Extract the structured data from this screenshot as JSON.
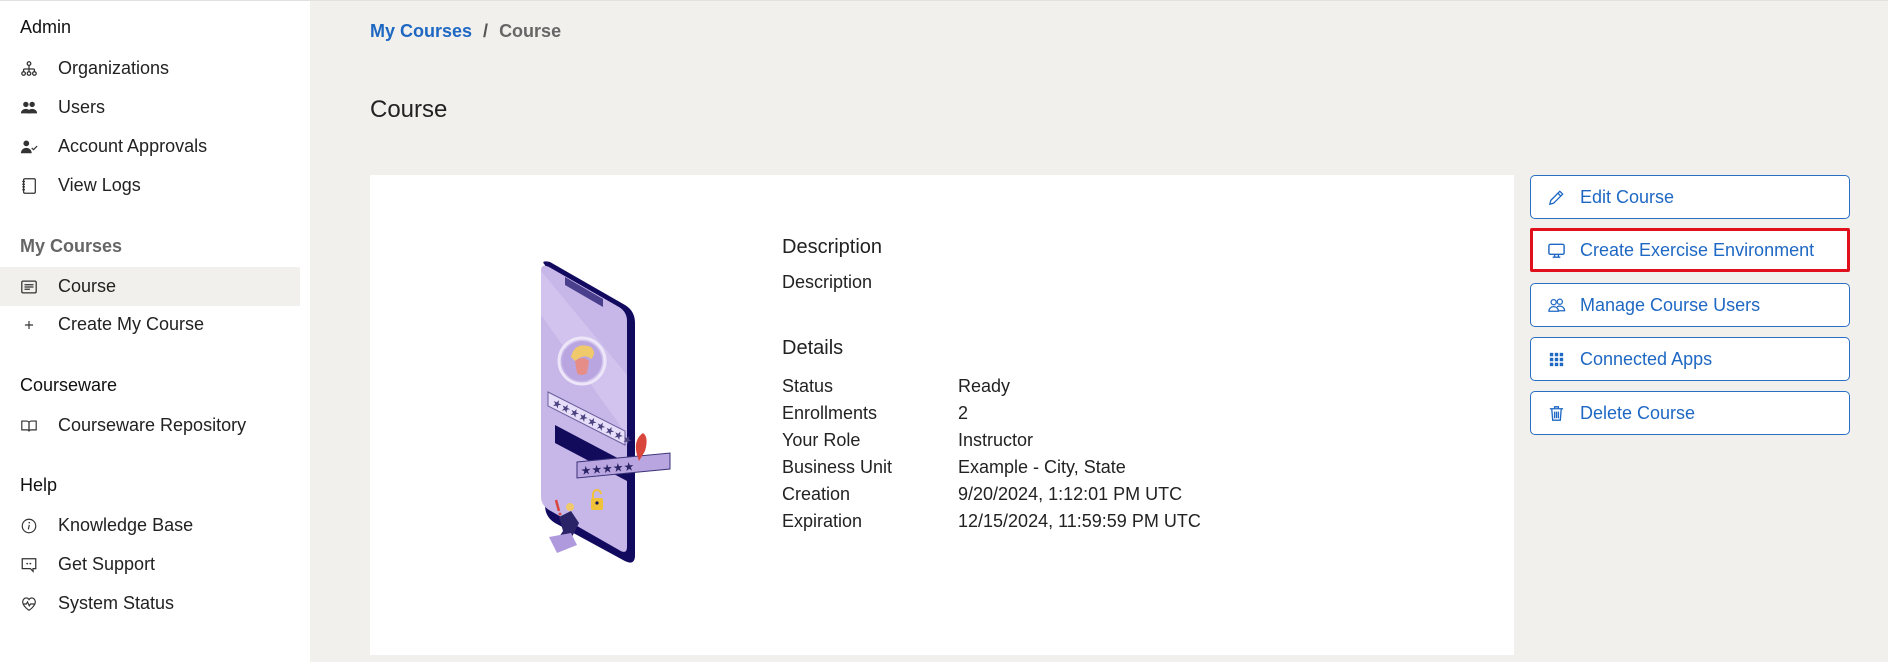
{
  "sidebar": {
    "sections": [
      {
        "title": "Admin",
        "items": [
          {
            "label": "Organizations",
            "icon": "org-chart-icon"
          },
          {
            "label": "Users",
            "icon": "users-icon"
          },
          {
            "label": "Account Approvals",
            "icon": "user-check-icon"
          },
          {
            "label": "View Logs",
            "icon": "notebook-icon"
          }
        ]
      },
      {
        "title": "My Courses",
        "items": [
          {
            "label": "Course",
            "icon": "course-card-icon",
            "active": true
          },
          {
            "label": "Create My Course",
            "icon": "plus-icon"
          }
        ]
      },
      {
        "title": "Courseware",
        "items": [
          {
            "label": "Courseware Repository",
            "icon": "book-icon"
          }
        ]
      },
      {
        "title": "Help",
        "items": [
          {
            "label": "Knowledge Base",
            "icon": "info-icon"
          },
          {
            "label": "Get Support",
            "icon": "chat-quote-icon"
          },
          {
            "label": "System Status",
            "icon": "heart-pulse-icon"
          }
        ]
      }
    ]
  },
  "breadcrumb": {
    "parent": "My Courses",
    "separator": "/",
    "current": "Course"
  },
  "page": {
    "title": "Course"
  },
  "course": {
    "description_heading": "Description",
    "description": "Description",
    "details_heading": "Details",
    "details": [
      {
        "key": "Status",
        "value": "Ready"
      },
      {
        "key": "Enrollments",
        "value": "2"
      },
      {
        "key": "Your Role",
        "value": "Instructor"
      },
      {
        "key": "Business Unit",
        "value": "Example - City, State"
      },
      {
        "key": "Creation",
        "value": "9/20/2024, 1:12:01 PM UTC"
      },
      {
        "key": "Expiration",
        "value": "12/15/2024, 11:59:59 PM UTC"
      }
    ]
  },
  "actions": [
    {
      "label": "Edit Course",
      "icon": "pencil-icon"
    },
    {
      "label": "Create Exercise Environment",
      "icon": "monitor-icon",
      "highlighted": true
    },
    {
      "label": "Manage Course Users",
      "icon": "user-group-icon"
    },
    {
      "label": "Connected Apps",
      "icon": "grid-icon"
    },
    {
      "label": "Delete Course",
      "icon": "trash-icon"
    }
  ],
  "colors": {
    "accent": "#1e68c3",
    "background": "#f1f0ec",
    "highlight": "#e0101d",
    "illustration_phone": "#110a5e",
    "illustration_screen": "#c7b6e8"
  }
}
